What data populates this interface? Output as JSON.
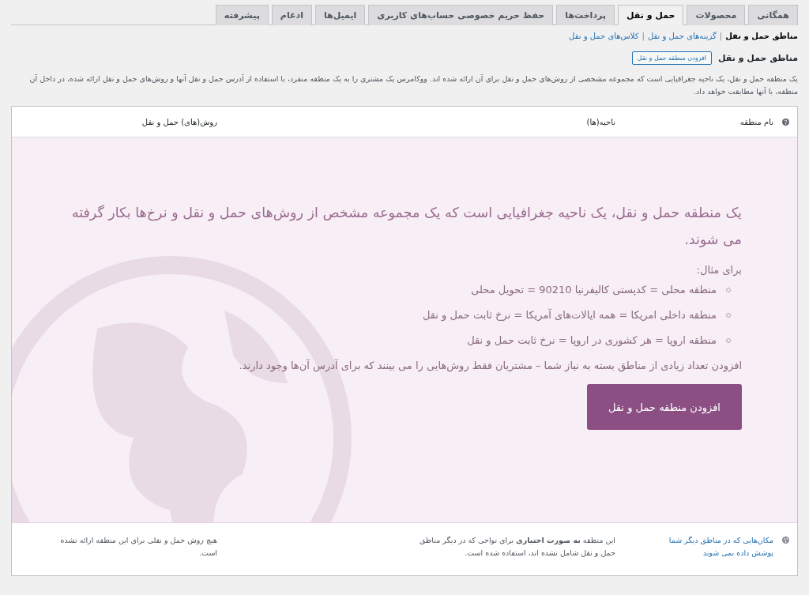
{
  "tabs": [
    {
      "label": "همگانی",
      "selected": false
    },
    {
      "label": "محصولات",
      "selected": false
    },
    {
      "label": "حمل و نقل",
      "selected": true
    },
    {
      "label": "پرداخت‌ها",
      "selected": false
    },
    {
      "label": "حفظ حریم خصوصی حساب‌های کاربری",
      "selected": false
    },
    {
      "label": "ایمیل‌ها",
      "selected": false
    },
    {
      "label": "ادغام",
      "selected": false
    },
    {
      "label": "پیشرفته",
      "selected": false
    }
  ],
  "subnav": [
    {
      "label": "مناطق حمل و نقل",
      "selected": true
    },
    {
      "label": "گزینه‌های حمل و نقل",
      "selected": false
    },
    {
      "label": "کلاس‌های حمل و نقل",
      "selected": false
    }
  ],
  "subnav_separator": "|",
  "heading": {
    "title": "مناطق حمل و نقل",
    "button": "افزودن منطقه حمل و نقل"
  },
  "description": "یک منطقه حمل و نقل، یک ناحیه جغرافیایی است که مجموعه مشخصی از روش‌های حمل و نقل برای آن ارائه شده اند. ووکامرس یک مشتری را به یک منطقه منفرد، با استفاده از آدرس حمل و نقل آنها و روش‌های حمل و نقل ارائه شده، در داخل آن منطقه، با آنها مطابقت خواهد داد.",
  "table": {
    "columns": [
      "نام منطقه",
      "ناحیه(ها)",
      "روش(های) حمل و نقل"
    ],
    "blank_state": {
      "lead": "یک منطقه حمل و نقل، یک ناحیه جغرافیایی است که یک مجموعه مشخص از روش‌های حمل و نقل و نرخ‌ها بکار گرفته می شوند.",
      "examples_title": "برای مثال:",
      "examples": [
        "منطقه محلی = کدپستی کالیفرنیا 90210 = تحویل محلی",
        "منطقه داخلی امریکا = همه ایالات‌های آمریکا = نرخ ثابت حمل و نقل",
        "منطقه اروپا = هر کشوری در اروپا = نرخ ثابت حمل و نقل"
      ],
      "note": "افزودن تعداد زیادی از مناطق بسته به نیاز شما – مشتریان فقط روش‌هایی را می بینند که برای آدرس آن‌ها وجود دارند.",
      "button": "افزودن منطقه حمل و نقل"
    },
    "footer_row": {
      "name": "مکان‌هایی که در مناطق دیگر شما پوشش داده نمی شوند",
      "regions": "این منطقه **به صورت اختیاری** برای نواحی که در دیگر مناطق حمل و نقل شامل نشده اند، استفاده شده است.",
      "methods": "هیچ روش حمل و نقلی برای این منطقه ارائه نشده است."
    }
  }
}
